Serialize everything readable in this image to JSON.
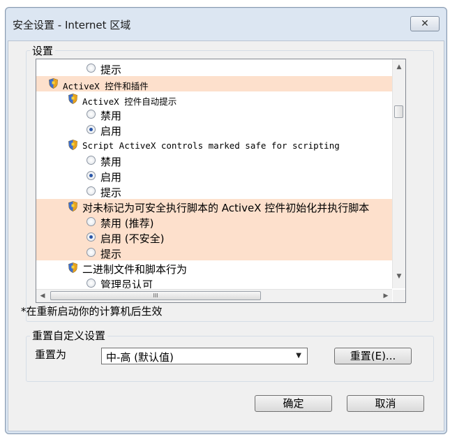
{
  "window": {
    "title": "安全设置 - Internet 区域",
    "close_glyph": "✕"
  },
  "settings_group": {
    "label": "设置"
  },
  "tree_rows": [
    {
      "kind": "radio",
      "label": "提示",
      "checked": false,
      "highlight": false,
      "indent": 0
    },
    {
      "kind": "category",
      "label": "ActiveX 控件和插件",
      "highlight": true,
      "indent": 0
    },
    {
      "kind": "setting",
      "label": "ActiveX 控件自动提示",
      "highlight": false,
      "indent": 1
    },
    {
      "kind": "radio",
      "label": "禁用",
      "checked": false,
      "highlight": false,
      "indent": 0
    },
    {
      "kind": "radio",
      "label": "启用",
      "checked": true,
      "highlight": false,
      "indent": 0
    },
    {
      "kind": "setting",
      "label": "Script ActiveX controls marked safe for scripting",
      "highlight": false,
      "indent": 1
    },
    {
      "kind": "radio",
      "label": "禁用",
      "checked": false,
      "highlight": false,
      "indent": 0
    },
    {
      "kind": "radio",
      "label": "启用",
      "checked": true,
      "highlight": false,
      "indent": 0
    },
    {
      "kind": "radio",
      "label": "提示",
      "checked": false,
      "highlight": false,
      "indent": 0
    },
    {
      "kind": "setting",
      "label": "对未标记为可安全执行脚本的 ActiveX 控件初始化并执行脚本",
      "highlight": true,
      "indent": 1
    },
    {
      "kind": "radio",
      "label": "禁用 (推荐)",
      "checked": false,
      "highlight": true,
      "indent": 0
    },
    {
      "kind": "radio",
      "label": "启用 (不安全)",
      "checked": true,
      "highlight": true,
      "indent": 0
    },
    {
      "kind": "radio",
      "label": "提示",
      "checked": false,
      "highlight": true,
      "indent": 0
    },
    {
      "kind": "setting",
      "label": "二进制文件和脚本行为",
      "highlight": false,
      "indent": 1
    },
    {
      "kind": "radio",
      "label": "管理员认可",
      "checked": false,
      "highlight": false,
      "indent": 0
    }
  ],
  "scrollbars": {
    "up": "▲",
    "down": "▼",
    "left": "◀",
    "right": "▶",
    "grip": "III"
  },
  "restart_note": "*在重新启动你的计算机后生效",
  "reset_group": {
    "label": "重置自定义设置",
    "reset_to_label": "重置为",
    "selected_level": "中-高 (默认值)",
    "combo_arrow": "▼",
    "reset_button": "重置(E)..."
  },
  "buttons": {
    "ok": "确定",
    "cancel": "取消"
  },
  "colors": {
    "highlight_row": "#fde0cc",
    "radio_dot": "#2a56a8",
    "window_frame": "#dce6f2"
  }
}
